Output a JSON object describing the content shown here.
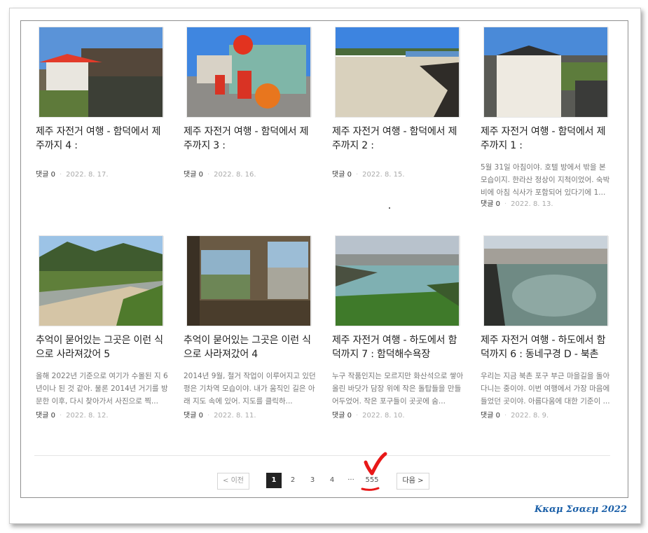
{
  "posts": [
    {
      "title": "제주 자전거 여행 - 함덕에서 제주까지 4 :",
      "excerpt": "",
      "comments": "댓글 0",
      "date": "2022. 8. 17."
    },
    {
      "title": "제주 자전거 여행 - 함덕에서 제주까지 3 :",
      "excerpt": "",
      "comments": "댓글 0",
      "date": "2022. 8. 16."
    },
    {
      "title": "제주 자전거 여행 - 함덕에서 제주까지 2 :",
      "excerpt": "",
      "comments": "댓글 0",
      "date": "2022. 8. 15."
    },
    {
      "title": "제주 자전거 여행 - 함덕에서 제주까지 1 :",
      "excerpt": "5월 31일 아침이야. 호텔 방에서 밖을 본 모습이지. 한라산 정상이 지척이었어. 숙박비에 아침 식사가 포함되어 있다기에 1...",
      "comments": "댓글 0",
      "date": "2022. 8. 13."
    },
    {
      "title": "추억이 묻어있는 그곳은 이런 식으로 사라져갔어 5",
      "excerpt": "올해 2022년 기준으로 여기가 수몰된 지 6년이나 된 것 같아. 물론 2014년 거기를 방문한 이후, 다시 찾아가서 사진으로 찍...",
      "comments": "댓글 0",
      "date": "2022. 8. 12."
    },
    {
      "title": "추억이 묻어있는 그곳은 이런 식으로 사라져갔어 4",
      "excerpt": "2014년 9월, 철거 작업이 이루어지고 있던 평은 기차역 모습이야. 내가 움직인 길은 아래 지도 속에 있어. 지도를 클릭하...",
      "comments": "댓글 0",
      "date": "2022. 8. 11."
    },
    {
      "title": "제주 자전거 여행 - 하도에서 함덕까지 7 : 함덕해수욕장",
      "excerpt": "누구 작품인지는 모르지만 화산석으로 쌓아 올린 바닷가 담장 위에 작은 돌탑들을 만들어두었어. 작은 포구들이 곳곳에 숨...",
      "comments": "댓글 0",
      "date": "2022. 8. 10."
    },
    {
      "title": "제주 자전거 여행 - 하도에서 함덕까지 6 : 동네구경 D - 북촌교...",
      "excerpt": "우리는 지금 북촌 포구 부근 마을길을 돌아다니는 중이야. 이번 여행에서 가장 마음에 들었던 곳이야. 아름다움에 대한 기준이 ...",
      "comments": "댓글 0",
      "date": "2022. 8. 9."
    }
  ],
  "pagination": {
    "prev_label": "< 이전",
    "next_label": "다음 >",
    "pages": [
      "1",
      "2",
      "3",
      "4"
    ],
    "ellipsis": "···",
    "last_page": "555",
    "active": "1"
  },
  "annotation": {
    "mark": "V",
    "color": "#e81818"
  },
  "signature": "Kκαμ Σσαεμ 2022",
  "colors": {
    "accent": "#1a5fa8",
    "active_page_bg": "#222222"
  }
}
